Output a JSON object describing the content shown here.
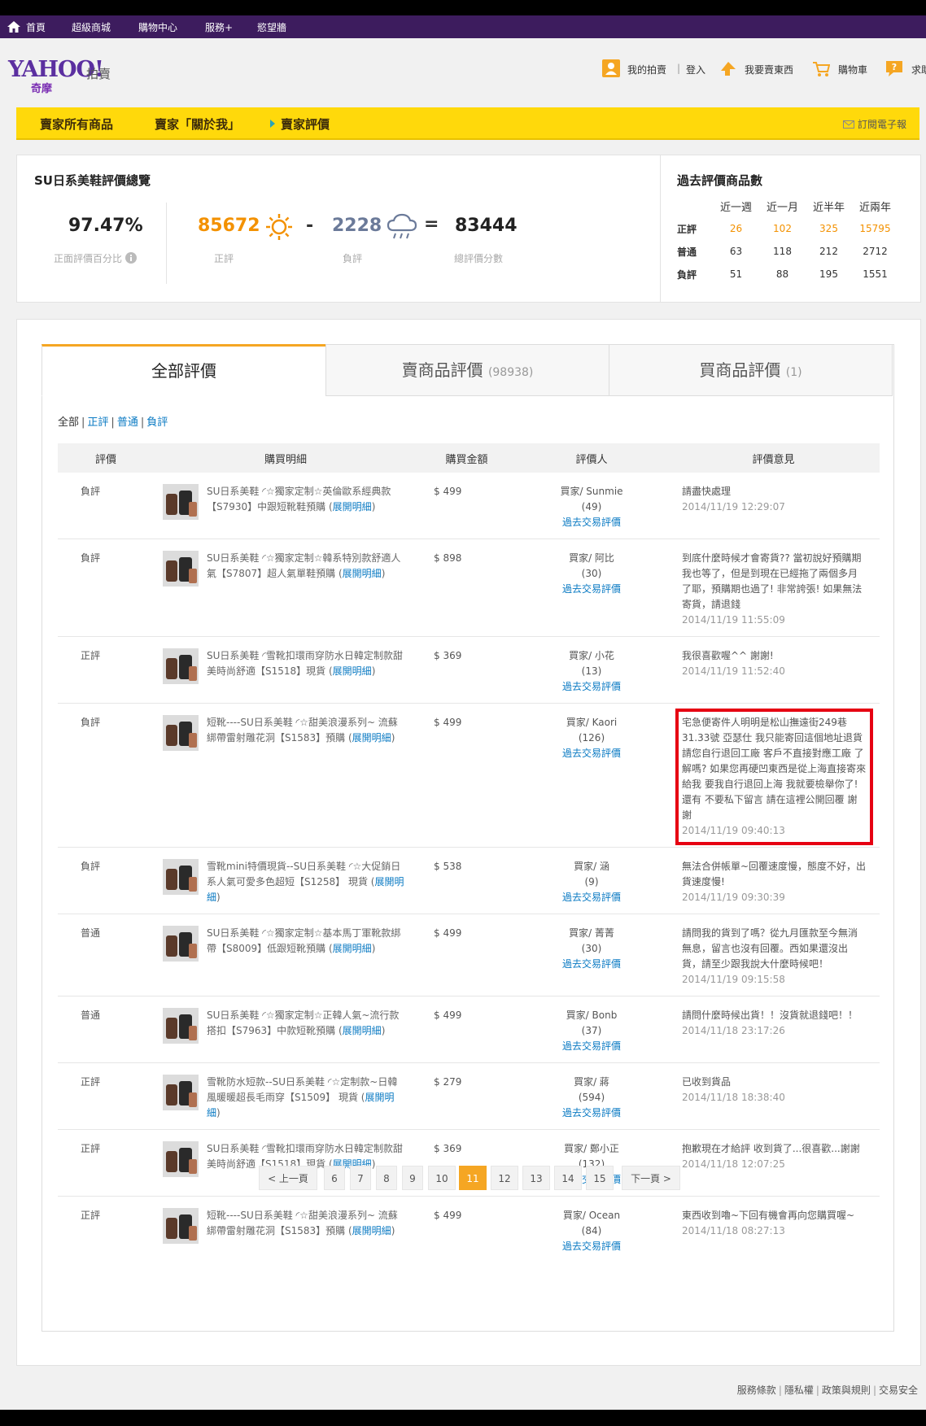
{
  "topnav": {
    "items": [
      "首頁",
      "超級商城",
      "購物中心",
      "服務+",
      "慾望牆"
    ]
  },
  "header": {
    "logo_text": "YAHOO!",
    "logo_sub": "奇摩",
    "logo_auction": "拍賣",
    "my_auction": "我的拍賣",
    "login": "登入",
    "sell": "我要賣東西",
    "cart": "購物車",
    "help": "求助"
  },
  "sellerbar": {
    "all_items": "賣家所有商品",
    "about": "賣家「關於我」",
    "ratings": "賣家評價",
    "subscribe": "訂閱電子報"
  },
  "summary": {
    "title": "SU日系美鞋評價總覽",
    "percent": "97.47%",
    "percent_label": "正面評價百分比",
    "positive": "85672",
    "positive_label": "正評",
    "minus": "-",
    "negative": "2228",
    "negative_label": "負評",
    "equals": "=",
    "total": "83444",
    "total_label": "總評價分數"
  },
  "past": {
    "title": "過去評價商品數",
    "headers": [
      "近一週",
      "近一月",
      "近半年",
      "近兩年"
    ],
    "rows": [
      {
        "label": "正評",
        "values": [
          "26",
          "102",
          "325",
          "15795"
        ]
      },
      {
        "label": "普通",
        "values": [
          "63",
          "118",
          "212",
          "2712"
        ]
      },
      {
        "label": "負評",
        "values": [
          "51",
          "88",
          "195",
          "1551"
        ]
      }
    ]
  },
  "tabs": [
    {
      "label": "全部評價",
      "count": ""
    },
    {
      "label": "賣商品評價",
      "count": "(98938)"
    },
    {
      "label": "買商品評價",
      "count": "(1)"
    }
  ],
  "filters": {
    "all": "全部",
    "items": [
      "正評",
      "普通",
      "負評"
    ]
  },
  "table": {
    "headers": [
      "評價",
      "購買明細",
      "購買金額",
      "評價人",
      "評價意見"
    ],
    "history_link": "過去交易評價",
    "expand_link": "展開明細",
    "rows": [
      {
        "type": "負評",
        "item": "SU日系美鞋 ◜☆獨家定制☆英倫歐系經典款【S7930】中跟短靴鞋預購",
        "price": "$ 499",
        "rater": "買家/ Sunmie",
        "count": "(49)",
        "comment": "請盡快處理",
        "time": "2014/11/19 12:29:07"
      },
      {
        "type": "負評",
        "item": "SU日系美鞋 ◜☆獨家定制☆韓系特別款舒適人氣【S7807】超人氣單鞋預購",
        "price": "$ 898",
        "rater": "買家/ 阿比",
        "count": "(30)",
        "comment": "到底什麼時候才會寄貨?? 當初說好預購期我也等了，但是到現在已經拖了兩個多月了耶，預購期也過了! 非常誇張! 如果無法寄貨，請退錢",
        "time": "2014/11/19 11:55:09"
      },
      {
        "type": "正評",
        "item": "SU日系美鞋 ◜雪靴扣環雨穿防水日韓定制款甜美時尚舒適【S1518】現貨",
        "price": "$ 369",
        "rater": "買家/ 小花",
        "count": "(13)",
        "comment": "我很喜歡喔^^ 謝謝!",
        "time": "2014/11/19 11:52:40"
      },
      {
        "type": "負評",
        "item": "短靴----SU日系美鞋 ◜☆甜美浪漫系列~ 流蘇綁帶雷射雕花洞【S1583】預購",
        "price": "$ 499",
        "rater": "買家/ Kaori",
        "count": "(126)",
        "comment": "宅急便寄件人明明是松山撫遠街249巷31.33號 亞瑟仕 我只能寄回這個地址退貨 請您自行退回工廠 客戶不直接對應工廠 了解嗎? 如果您再硬凹東西是從上海直接寄來給我 要我自行退回上海 我就要檢舉你了! 還有 不要私下留言 請在這裡公開回覆 謝謝",
        "time": "2014/11/19 09:40:13"
      },
      {
        "type": "負評",
        "item": "雪靴mini特價現貨--SU日系美鞋 ◜☆大促銷日系人氣可愛多色超短【S1258】 現貨",
        "price": "$ 538",
        "rater": "買家/ 涵",
        "count": "(9)",
        "comment": "無法合併帳單~回覆速度慢，態度不好，出貨速度慢!",
        "time": "2014/11/19 09:30:39"
      },
      {
        "type": "普通",
        "item": "SU日系美鞋 ◜☆獨家定制☆基本馬丁軍靴款綁帶【S8009】低跟短靴預購",
        "price": "$ 499",
        "rater": "買家/ 菁菁",
        "count": "(30)",
        "comment": "請問我的貨到了嗎？從九月匯款至今無消無息，留言也沒有回覆。西如果還沒出貨，請至少跟我說大什麼時候吧！",
        "time": "2014/11/19 09:15:58"
      },
      {
        "type": "普通",
        "item": "SU日系美鞋 ◜☆獨家定制☆正韓人氣~流行款搭扣【S7963】中款短靴預購",
        "price": "$ 499",
        "rater": "買家/ Bonb",
        "count": "(37)",
        "comment": "請問什麼時候出貨！！沒貨就退錢吧！！",
        "time": "2014/11/18 23:17:26"
      },
      {
        "type": "正評",
        "item": "雪靴防水短款--SU日系美鞋 ◜☆定制款~日韓風暖暖超長毛雨穿【S1509】 現貨",
        "price": "$ 279",
        "rater": "買家/ 蔣",
        "count": "(594)",
        "comment": "已收到貨品",
        "time": "2014/11/18 18:38:40"
      },
      {
        "type": "正評",
        "item": "SU日系美鞋 ◜雪靴扣環雨穿防水日韓定制款甜美時尚舒適【S1518】現貨",
        "price": "$ 369",
        "rater": "買家/ 鄭小正",
        "count": "(132)",
        "comment": "抱歉現在才給評 收到貨了...很喜歡...謝謝",
        "time": "2014/11/18 12:07:25"
      },
      {
        "type": "正評",
        "item": "短靴----SU日系美鞋 ◜☆甜美浪漫系列~ 流蘇綁帶雷射雕花洞【S1583】預購",
        "price": "$ 499",
        "rater": "買家/ Ocean",
        "count": "(84)",
        "comment": "東西收到嚕~下回有機會再向您購買喔~",
        "time": "2014/11/18 08:27:13"
      }
    ]
  },
  "pager": {
    "prev": "< 上一頁",
    "pages": [
      "6",
      "7",
      "8",
      "9",
      "10",
      "11",
      "12",
      "13",
      "14",
      "15"
    ],
    "current": "11",
    "next": "下一頁 >"
  },
  "footer": [
    "服務條款",
    "隱私權",
    "政策與規則",
    "交易安全"
  ]
}
